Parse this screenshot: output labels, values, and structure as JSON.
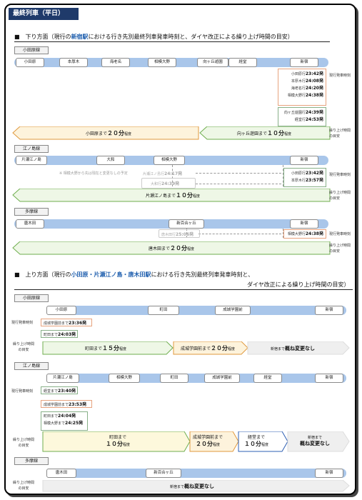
{
  "title": "最終列車（平日）",
  "down": {
    "heading_pre": "■　下り方面（現行の",
    "heading_station": "新宿駅",
    "heading_post": "における行き先別最終列車発車時刻と、ダイヤ改正による繰り上げ時間の目安）"
  },
  "side": {
    "current": "現行発車時刻",
    "move_l1": "繰り上げ時間",
    "move_l2": "の目安"
  },
  "unit": "発",
  "dai": "程度",
  "odakyu": {
    "name": "小田原線",
    "stations": [
      "小田原",
      "本厚木",
      "海老名",
      "相模大野",
      "向ヶ丘遊園",
      "経堂",
      "新宿"
    ],
    "t1": [
      {
        "l": "小田原行",
        "t": "23:42"
      },
      {
        "l": "本厚木行",
        "t": "24:08"
      },
      {
        "l": "海老名行",
        "t": "24:20"
      },
      {
        "l": "相模大野行",
        "t": "24:38"
      }
    ],
    "t2": [
      {
        "l": "向ヶ丘遊園行",
        "t": "24:39"
      },
      {
        "l": "経堂行",
        "t": "24:53"
      }
    ],
    "a1": {
      "pre": "小田原まで",
      "num": "２０分",
      "post": "程度"
    },
    "a2": {
      "pre": "向ヶ丘遊園まで",
      "num": "１０分",
      "post": "程度"
    }
  },
  "enoshima": {
    "name": "江ノ島線",
    "stations": [
      "片瀬江ノ島",
      "大和",
      "相模大野",
      "新宿"
    ],
    "note": "※ 相模大野から先は現在と変更なしの予定",
    "g1": {
      "l": "片瀬江ノ島行",
      "t": "24:17"
    },
    "g2": {
      "l": "大和行",
      "t": "24:39"
    },
    "t1": [
      {
        "l": "小田原行",
        "t": "23:42"
      },
      {
        "l": "本厚木行",
        "t": "23:57"
      }
    ],
    "a": {
      "pre": "片瀬江ノ島まで",
      "num": "１０分",
      "post": "程度"
    }
  },
  "tama": {
    "name": "多摩線",
    "stations": [
      "唐木田",
      "新百合ヶ丘",
      "新宿"
    ],
    "g1": {
      "l": "唐木田行",
      "t": "25:06"
    },
    "t1": {
      "l": "相模大野行",
      "t": "24:38"
    },
    "a": {
      "pre": "唐木田まで",
      "num": "２０分",
      "post": "程度"
    }
  },
  "up": {
    "heading_pre": "■　上り方面（現行の",
    "heading_station": "小田原・片瀬江ノ島・唐木田駅",
    "heading_post": "における行き先別最終列車発車時刻と、",
    "heading2": "ダイヤ改正による繰り上げ時間の目安）"
  },
  "uo": {
    "name": "小田原線",
    "stations": [
      "小田原",
      "町田",
      "成城学園前",
      "新宿"
    ],
    "t1": {
      "l": "成城学園前まで",
      "t": "23:36"
    },
    "t2": {
      "l": "町田まで",
      "t": "24:03"
    },
    "a1": {
      "pre": "町田まで",
      "num": "１５分",
      "post": "程度"
    },
    "a2": {
      "pre": "成城学園前まで",
      "num": "２０分",
      "post": "程度"
    },
    "a3": {
      "pre": "新宿まで",
      "bold": "概ね変更なし"
    }
  },
  "ue": {
    "name": "江ノ島線",
    "stations": [
      "片瀬江ノ島",
      "相模大野",
      "町田",
      "成城学園前",
      "経堂",
      "新宿"
    ],
    "t1": {
      "l": "経堂まで",
      "t": "23:40"
    },
    "t2": {
      "l": "成城学園前まで",
      "t": "23:53"
    },
    "t3": [
      {
        "l": "町田まで",
        "t": "24:04"
      },
      {
        "l": "相模大野まで",
        "t": "24:25"
      }
    ],
    "a1": {
      "pre": "町田まで",
      "num": "１０分",
      "post": "程度"
    },
    "a2": {
      "pre": "成城学園前まで",
      "num": "２０分",
      "post": "程度"
    },
    "a3": {
      "pre": "経堂まで",
      "num": "１０分",
      "post": "程度"
    },
    "a4": {
      "pre": "新宿まで",
      "bold": "概ね変更なし"
    }
  },
  "ut": {
    "name": "多摩線",
    "stations": [
      "唐木田",
      "新百合ヶ丘",
      "新宿"
    ],
    "a": {
      "pre": "新宿まで",
      "bold": "概ね変更なし"
    }
  }
}
